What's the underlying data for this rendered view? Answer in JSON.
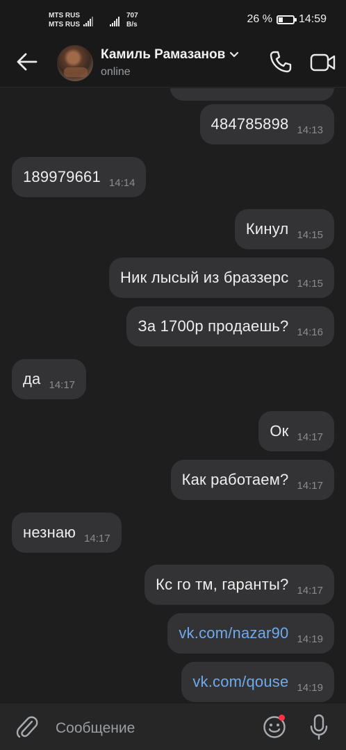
{
  "status_bar": {
    "carrier_1": "MTS RUS",
    "carrier_2": "MTS RUS",
    "speed_value": "707",
    "speed_unit": "B/s",
    "battery": "26 %",
    "battery_level": 0.26,
    "time": "14:59"
  },
  "header": {
    "back_icon": "arrow-left-icon",
    "contact_name": "Камиль Рамазанов",
    "contact_status": "online",
    "call_icon": "phone-icon",
    "video_icon": "video-camera-icon"
  },
  "messages": [
    {
      "dir": "out",
      "text": "484785898",
      "time": "14:13"
    },
    {
      "dir": "in",
      "text": "189979661",
      "time": "14:14"
    },
    {
      "dir": "out",
      "text": "Кинул",
      "time": "14:15"
    },
    {
      "dir": "out",
      "text": "Ник лысый из браззерс",
      "time": "14:15"
    },
    {
      "dir": "out",
      "text": "За  1700р продаешь?",
      "time": "14:16"
    },
    {
      "dir": "in",
      "text": "да",
      "time": "14:17"
    },
    {
      "dir": "out",
      "text": "Ок",
      "time": "14:17"
    },
    {
      "dir": "out",
      "text": "Как работаем?",
      "time": "14:17"
    },
    {
      "dir": "in",
      "text": "незнаю",
      "time": "14:17"
    },
    {
      "dir": "out",
      "text": "Кс го тм, гаранты?",
      "time": "14:17"
    },
    {
      "dir": "out",
      "text": "vk.com/nazar90",
      "time": "14:19",
      "link": true
    },
    {
      "dir": "out",
      "text": "vk.com/qouse",
      "time": "14:19",
      "link": true
    }
  ],
  "composer": {
    "attach_icon": "paperclip-icon",
    "placeholder": "Сообщение",
    "emoji_icon": "smiley-icon",
    "mic_icon": "microphone-icon"
  },
  "colors": {
    "background": "#1e1e1f",
    "bubble": "#333335",
    "link": "#71aaeb",
    "notification_dot": "#ff3347"
  }
}
